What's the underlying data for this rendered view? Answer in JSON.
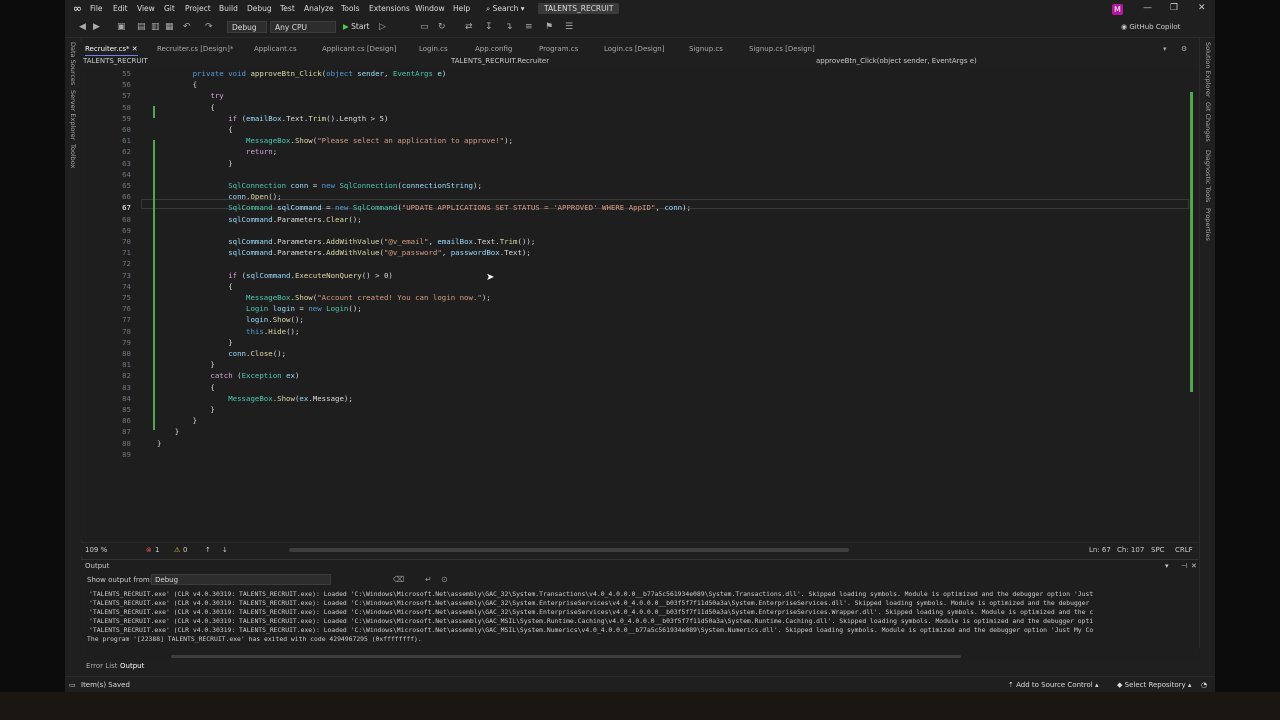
{
  "menubar": {
    "items": [
      "File",
      "Edit",
      "View",
      "Git",
      "Project",
      "Build",
      "Debug",
      "Test",
      "Analyze",
      "Tools",
      "Extensions",
      "Window",
      "Help"
    ],
    "search": "Search",
    "solution_title": "TALENTS_RECRUIT",
    "avatar_letter": "M"
  },
  "toolbar": {
    "config": "Debug",
    "platform": "Any CPU",
    "start_label": "Start",
    "copilot_label": "GitHub Copilot"
  },
  "tabs": [
    {
      "label": "Recruiter.cs*",
      "active": true
    },
    {
      "label": "Recruiter.cs [Design]*",
      "active": false
    },
    {
      "label": "Applicant.cs",
      "active": false
    },
    {
      "label": "Applicant.cs [Design]",
      "active": false
    },
    {
      "label": "Login.cs",
      "active": false
    },
    {
      "label": "App.config",
      "active": false
    },
    {
      "label": "Program.cs",
      "active": false
    },
    {
      "label": "Login.cs [Design]",
      "active": false
    },
    {
      "label": "Signup.cs",
      "active": false
    },
    {
      "label": "Signup.cs [Design]",
      "active": false
    }
  ],
  "navbar": {
    "project": "TALENTS_RECRUIT",
    "class": "TALENTS_RECRUIT.Recruiter",
    "member": "approveBtn_Click(object sender, EventArgs e)"
  },
  "left_panels": [
    "Data Sources",
    "Server Explorer",
    "Toolbox"
  ],
  "right_panels": [
    "Solution Explorer",
    "Git Changes",
    "Diagnostic Tools",
    "Properties"
  ],
  "code_lines": [
    {
      "n": "55",
      "segs": [
        [
          "",
          "        "
        ],
        [
          "kw",
          "private void "
        ],
        [
          "fn",
          "approveBtn_Click"
        ],
        [
          "",
          "("
        ],
        [
          "kw",
          "object "
        ],
        [
          "vr",
          "sender"
        ],
        [
          "",
          ", "
        ],
        [
          "ty",
          "EventArgs "
        ],
        [
          "vr",
          "e"
        ],
        [
          "",
          ")"
        ]
      ]
    },
    {
      "n": "56",
      "segs": [
        [
          "",
          "        {"
        ]
      ]
    },
    {
      "n": "57",
      "segs": [
        [
          "",
          "            "
        ],
        [
          "ct",
          "try"
        ]
      ]
    },
    {
      "n": "58",
      "segs": [
        [
          "",
          "            {"
        ]
      ]
    },
    {
      "n": "59",
      "segs": [
        [
          "",
          "                "
        ],
        [
          "ct",
          "if "
        ],
        [
          "",
          "("
        ],
        [
          "vr",
          "emailBox"
        ],
        [
          "",
          ".Text."
        ],
        [
          "fn",
          "Trim"
        ],
        [
          "",
          "().Length > 5)"
        ]
      ]
    },
    {
      "n": "60",
      "segs": [
        [
          "",
          "                {"
        ]
      ]
    },
    {
      "n": "61",
      "segs": [
        [
          "",
          "                    "
        ],
        [
          "ty",
          "MessageBox"
        ],
        [
          "",
          "."
        ],
        [
          "fn",
          "Show"
        ],
        [
          "",
          "("
        ],
        [
          "st",
          "\"Please select an application to approve!\""
        ],
        [
          "",
          ");"
        ]
      ]
    },
    {
      "n": "62",
      "segs": [
        [
          "",
          "                    "
        ],
        [
          "ct",
          "return"
        ],
        [
          "",
          ";"
        ]
      ]
    },
    {
      "n": "63",
      "segs": [
        [
          "",
          "                }"
        ]
      ]
    },
    {
      "n": "64",
      "segs": [
        [
          "",
          ""
        ]
      ]
    },
    {
      "n": "65",
      "segs": [
        [
          "",
          "                "
        ],
        [
          "ty",
          "SqlConnection "
        ],
        [
          "vr",
          "conn"
        ],
        [
          "",
          " = "
        ],
        [
          "kw",
          "new "
        ],
        [
          "ty",
          "SqlConnection"
        ],
        [
          "",
          "("
        ],
        [
          "vr",
          "connectionString"
        ],
        [
          "",
          ");"
        ]
      ]
    },
    {
      "n": "66",
      "segs": [
        [
          "",
          "                "
        ],
        [
          "vr",
          "conn"
        ],
        [
          "",
          "."
        ],
        [
          "fn",
          "Open"
        ],
        [
          "",
          "();"
        ]
      ]
    },
    {
      "n": "67",
      "segs": [
        [
          "",
          "                "
        ],
        [
          "ty",
          "SqlCommand "
        ],
        [
          "vr",
          "sqlCommand"
        ],
        [
          "",
          " = "
        ],
        [
          "kw",
          "new "
        ],
        [
          "ty",
          "SqlCommand"
        ],
        [
          "",
          "("
        ],
        [
          "st",
          "\"UPDATE APPLICATIONS SET STATUS = 'APPROVED' WHERE AppID\""
        ],
        [
          "",
          ", "
        ],
        [
          "vr",
          "conn"
        ],
        [
          "",
          ");"
        ]
      ]
    },
    {
      "n": "68",
      "segs": [
        [
          "",
          "                "
        ],
        [
          "vr",
          "sqlCommand"
        ],
        [
          "",
          ".Parameters."
        ],
        [
          "fn",
          "Clear"
        ],
        [
          "",
          "();"
        ]
      ]
    },
    {
      "n": "69",
      "segs": [
        [
          "",
          ""
        ]
      ]
    },
    {
      "n": "70",
      "segs": [
        [
          "",
          "                "
        ],
        [
          "vr",
          "sqlCommand"
        ],
        [
          "",
          ".Parameters."
        ],
        [
          "fn",
          "AddWithValue"
        ],
        [
          "",
          "("
        ],
        [
          "st",
          "\"@v_email\""
        ],
        [
          "",
          ", "
        ],
        [
          "vr",
          "emailBox"
        ],
        [
          "",
          ".Text."
        ],
        [
          "fn",
          "Trim"
        ],
        [
          "",
          "());"
        ]
      ]
    },
    {
      "n": "71",
      "segs": [
        [
          "",
          "                "
        ],
        [
          "vr",
          "sqlCommand"
        ],
        [
          "",
          ".Parameters."
        ],
        [
          "fn",
          "AddWithValue"
        ],
        [
          "",
          "("
        ],
        [
          "st",
          "\"@v_password\""
        ],
        [
          "",
          ", "
        ],
        [
          "vr",
          "passwordBox"
        ],
        [
          "",
          ".Text);"
        ]
      ]
    },
    {
      "n": "72",
      "segs": [
        [
          "",
          ""
        ]
      ]
    },
    {
      "n": "73",
      "segs": [
        [
          "",
          "                "
        ],
        [
          "ct",
          "if "
        ],
        [
          "",
          "("
        ],
        [
          "vr",
          "sqlCommand"
        ],
        [
          "",
          "."
        ],
        [
          "fn",
          "ExecuteNonQuery"
        ],
        [
          "",
          "() > 0)"
        ]
      ]
    },
    {
      "n": "74",
      "segs": [
        [
          "",
          "                {"
        ]
      ]
    },
    {
      "n": "75",
      "segs": [
        [
          "",
          "                    "
        ],
        [
          "ty",
          "MessageBox"
        ],
        [
          "",
          "."
        ],
        [
          "fn",
          "Show"
        ],
        [
          "",
          "("
        ],
        [
          "st",
          "\"Account created! You can login now.\""
        ],
        [
          "",
          ");"
        ]
      ]
    },
    {
      "n": "76",
      "segs": [
        [
          "",
          "                    "
        ],
        [
          "ty",
          "Login "
        ],
        [
          "vr",
          "login"
        ],
        [
          "",
          " = "
        ],
        [
          "kw",
          "new "
        ],
        [
          "ty",
          "Login"
        ],
        [
          "",
          "();"
        ]
      ]
    },
    {
      "n": "77",
      "segs": [
        [
          "",
          "                    "
        ],
        [
          "vr",
          "login"
        ],
        [
          "",
          "."
        ],
        [
          "fn",
          "Show"
        ],
        [
          "",
          "();"
        ]
      ]
    },
    {
      "n": "78",
      "segs": [
        [
          "",
          "                    "
        ],
        [
          "kw",
          "this"
        ],
        [
          "",
          "."
        ],
        [
          "fn",
          "Hide"
        ],
        [
          "",
          "();"
        ]
      ]
    },
    {
      "n": "79",
      "segs": [
        [
          "",
          "                }"
        ]
      ]
    },
    {
      "n": "80",
      "segs": [
        [
          "",
          "                "
        ],
        [
          "vr",
          "conn"
        ],
        [
          "",
          "."
        ],
        [
          "fn",
          "Close"
        ],
        [
          "",
          "();"
        ]
      ]
    },
    {
      "n": "81",
      "segs": [
        [
          "",
          "            }"
        ]
      ]
    },
    {
      "n": "82",
      "segs": [
        [
          "",
          "            "
        ],
        [
          "ct",
          "catch "
        ],
        [
          "",
          "("
        ],
        [
          "ty",
          "Exception "
        ],
        [
          "vr",
          "ex"
        ],
        [
          "",
          ")"
        ]
      ]
    },
    {
      "n": "83",
      "segs": [
        [
          "",
          "            {"
        ]
      ]
    },
    {
      "n": "84",
      "segs": [
        [
          "",
          "                "
        ],
        [
          "ty",
          "MessageBox"
        ],
        [
          "",
          "."
        ],
        [
          "fn",
          "Show"
        ],
        [
          "",
          "("
        ],
        [
          "vr",
          "ex"
        ],
        [
          "",
          ".Message);"
        ]
      ]
    },
    {
      "n": "85",
      "segs": [
        [
          "",
          "            }"
        ]
      ]
    },
    {
      "n": "86",
      "segs": [
        [
          "",
          "        }"
        ]
      ]
    },
    {
      "n": "87",
      "segs": [
        [
          "",
          "    }"
        ]
      ]
    },
    {
      "n": "88",
      "segs": [
        [
          "",
          "}"
        ]
      ]
    },
    {
      "n": "89",
      "segs": [
        [
          "",
          ""
        ]
      ]
    }
  ],
  "current_line": "67",
  "editor_status": {
    "zoom": "109 %",
    "errors": "1",
    "warnings": "0",
    "position": "Ln: 67",
    "column": "Ch: 107",
    "spc": "SPC",
    "crlf": "CRLF"
  },
  "output": {
    "title": "Output",
    "show_from_label": "Show output from:",
    "source": "Debug",
    "lines": [
      "'TALENTS_RECRUIT.exe' (CLR v4.0.30319: TALENTS_RECRUIT.exe): Loaded 'C:\\Windows\\Microsoft.Net\\assembly\\GAC_32\\System.Transactions\\v4.0_4.0.0.0__b77a5c561934e089\\System.Transactions.dll'. Skipped loading symbols. Module is optimized and the debugger option 'Just",
      "'TALENTS_RECRUIT.exe' (CLR v4.0.30319: TALENTS_RECRUIT.exe): Loaded 'C:\\Windows\\Microsoft.Net\\assembly\\GAC_32\\System.EnterpriseServices\\v4.0_4.0.0.0__b03f5f7f11d50a3a\\System.EnterpriseServices.dll'. Skipped loading symbols. Module is optimized and the debugger",
      "'TALENTS_RECRUIT.exe' (CLR v4.0.30319: TALENTS_RECRUIT.exe): Loaded 'C:\\Windows\\Microsoft.Net\\assembly\\GAC_32\\System.EnterpriseServices\\v4.0_4.0.0.0__b03f5f7f11d50a3a\\System.EnterpriseServices.Wrapper.dll'. Skipped loading symbols. Module is optimized and the c",
      "'TALENTS_RECRUIT.exe' (CLR v4.0.30319: TALENTS_RECRUIT.exe): Loaded 'C:\\Windows\\Microsoft.Net\\assembly\\GAC_MSIL\\System.Runtime.Caching\\v4.0_4.0.0.0__b03f5f7f11d50a3a\\System.Runtime.Caching.dll'. Skipped loading symbols. Module is optimized and the debugger opti",
      "'TALENTS_RECRUIT.exe' (CLR v4.0.30319: TALENTS_RECRUIT.exe): Loaded 'C:\\Windows\\Microsoft.Net\\assembly\\GAC_MSIL\\System.Numerics\\v4.0_4.0.0.0__b77a5c561934e089\\System.Numerics.dll'. Skipped loading symbols. Module is optimized and the debugger option 'Just My Co",
      "The program '[22388] TALENTS_RECRUIT.exe' has exited with code 4294967295 (0xffffffff)."
    ]
  },
  "bottom_tabs": [
    "Error List",
    "Output"
  ],
  "statusbar": {
    "message": "Item(s) Saved",
    "add_source": "Add to Source Control",
    "select_repo": "Select Repository"
  }
}
